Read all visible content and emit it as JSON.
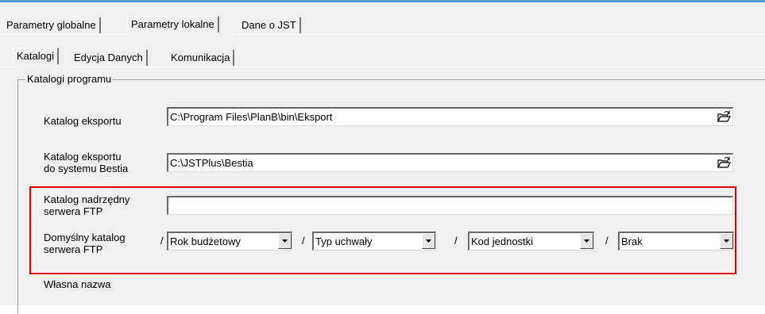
{
  "main_tabs": [
    "Parametry globalne",
    "Parametry lokalne",
    "Dane o JST"
  ],
  "sub_tabs": [
    "Katalogi",
    "Edycja Danych",
    "Komunikacja"
  ],
  "group_title": "Katalogi programu",
  "rows": {
    "export": {
      "label": "Katalog eksportu",
      "value": "C:\\Program Files\\PlanB\\bin\\Eksport"
    },
    "bestia": {
      "label_line1": "Katalog eksportu",
      "label_line2": "do systemu  Bestia",
      "value": "C:\\JSTPlus\\Bestia"
    },
    "ftp_parent": {
      "label_line1": "Katalog nadrzędny",
      "label_line2": "serwera FTP",
      "value": ""
    },
    "ftp_default": {
      "label_line1": "Domyślny katalog",
      "label_line2": "serwera FTP",
      "separator": "/",
      "selects": [
        "Rok budżetowy",
        "Typ uchwały",
        "Kod jednostki",
        "Brak"
      ]
    },
    "own_name": {
      "label": "Własna nazwa"
    }
  },
  "colors": {
    "highlight": "#e00000",
    "panel": "#f0f0f0"
  },
  "icons": {
    "browse": "open-folder-icon",
    "dropdown": "dropdown-arrow-icon"
  }
}
